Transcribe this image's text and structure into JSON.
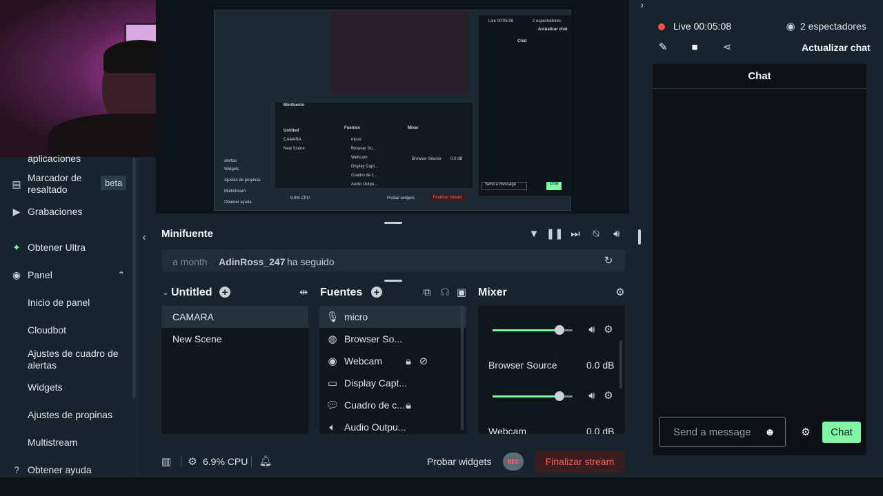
{
  "sidebar": {
    "partial_top": "aplicaciones",
    "highlight": {
      "label": "Marcador de resaltado",
      "badge": "beta"
    },
    "recordings": "Grabaciones",
    "ultra": "Obtener Ultra",
    "panel": "Panel",
    "sub": [
      "Inicio de panel",
      "Cloudbot",
      "Ajustes de cuadro de alertas",
      "Widgets",
      "Ajustes de propinas",
      "Multistream"
    ],
    "help": "Obtener ayuda"
  },
  "preview": {
    "mini_texts": [
      "Minifuente",
      "a month",
      "AdinRoss_247",
      "ha seguido",
      "Untitled",
      "Fuentes",
      "Mixer",
      "CAMARA",
      "New Scene",
      "micro",
      "Browser So...",
      "Webcam",
      "Display Capt...",
      "Cuadro de c...",
      "Audio Outpu...",
      "Browser Source",
      "0.0 dB",
      "Probar widgets",
      "Finalizar stream",
      "6.9% CPU",
      "Live 00:05:08",
      "2 espectadores",
      "Actualizar chat",
      "Chat",
      "Send a message",
      "alertas",
      "Widgets",
      "Ajustes de propinas",
      "Multistream",
      "Obtener ayuda",
      "Chat"
    ]
  },
  "minifuente": {
    "title": "Minifuente",
    "event": {
      "time": "a month",
      "user": "AdinRoss_247",
      "action": "ha seguido"
    }
  },
  "scenes": {
    "title": "Untitled",
    "items": [
      "CAMARA",
      "New Scene"
    ]
  },
  "sources": {
    "title": "Fuentes",
    "items": [
      "micro",
      "Browser So...",
      "Webcam",
      "Display Capt...",
      "Cuadro de c...",
      "Audio Outpu..."
    ]
  },
  "mixer": {
    "title": "Mixer",
    "channels": [
      {
        "name": "",
        "db": "",
        "level": 0.84
      },
      {
        "name": "Browser Source",
        "db": "0.0 dB",
        "level": 0.84
      },
      {
        "name": "Webcam",
        "db": "0.0 dB",
        "level": 0.84
      }
    ]
  },
  "status": {
    "cpu": "6.9% CPU",
    "test_widgets": "Probar widgets",
    "rec": "REC",
    "end_stream": "Finalizar stream"
  },
  "right": {
    "live": "Live",
    "time": "00:05:08",
    "viewers": "2 espectadores",
    "refresh_chat": "Actualizar chat",
    "chat_title": "Chat",
    "input_placeholder": "Send a message",
    "send": "Chat"
  },
  "colors": {
    "accent_green": "#80f5a5",
    "live_red": "#ff4d4d",
    "bg": "#17242d"
  }
}
